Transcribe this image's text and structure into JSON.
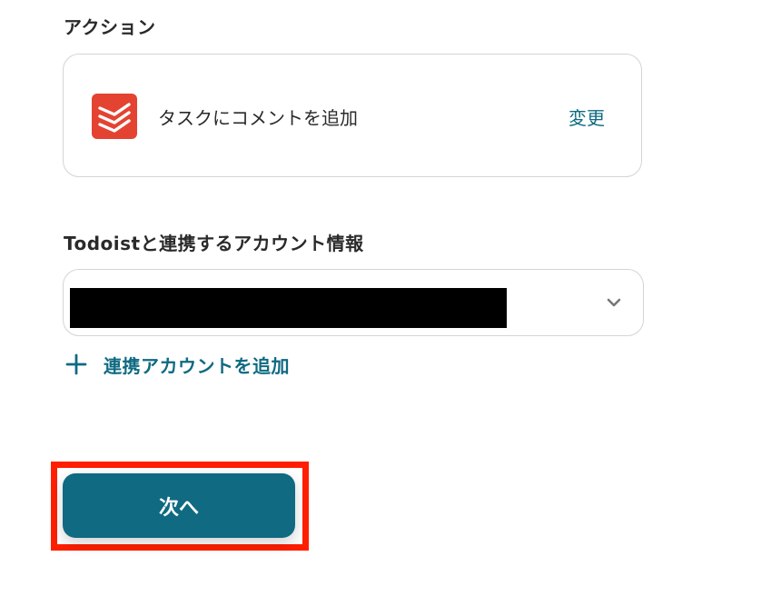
{
  "action_section": {
    "heading": "アクション",
    "app_icon": "todoist-logo-icon",
    "action_name": "タスクにコメントを追加",
    "change_label": "変更"
  },
  "account_section": {
    "heading": "Todoistと連携するアカウント情報",
    "selected_value": "",
    "dropdown_icon": "chevron-down-icon",
    "add_account_icon": "plus-icon",
    "add_account_label": "連携アカウントを追加"
  },
  "footer": {
    "next_label": "次へ"
  },
  "colors": {
    "accent": "#0f6a82",
    "todoist_red": "#e44332",
    "highlight": "#ff1f00",
    "border": "#d4d4d4"
  }
}
